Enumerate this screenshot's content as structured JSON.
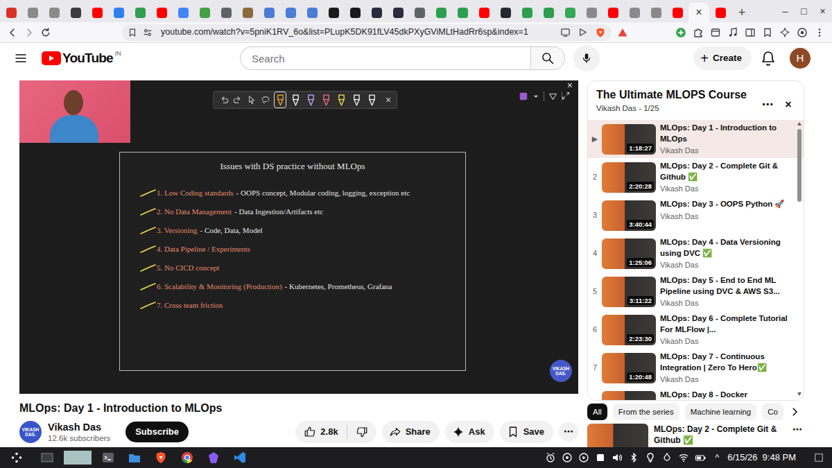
{
  "browser": {
    "tabs": [
      {
        "color": "#d93025",
        "selected": false
      },
      {
        "color": "#8a8a8a",
        "selected": false
      },
      {
        "color": "#8a8a8a",
        "selected": false
      },
      {
        "color": "#3b3b3b",
        "selected": false
      },
      {
        "color": "#ff0000",
        "selected": false
      },
      {
        "color": "#2f80ed",
        "selected": false
      },
      {
        "color": "#2e9e4f",
        "selected": false
      },
      {
        "color": "#ff0000",
        "selected": false
      },
      {
        "color": "#4285f4",
        "selected": false
      },
      {
        "color": "#43a047",
        "selected": false
      },
      {
        "color": "#5f6368",
        "selected": false
      },
      {
        "color": "#8b6b3d",
        "selected": false
      },
      {
        "color": "#4a7dd6",
        "selected": false
      },
      {
        "color": "#4a7dd6",
        "selected": false
      },
      {
        "color": "#4a7dd6",
        "selected": false
      },
      {
        "color": "#1a1a1a",
        "selected": false
      },
      {
        "color": "#1a1a1a",
        "selected": false
      },
      {
        "color": "#2b2b3b",
        "selected": false
      },
      {
        "color": "#2b2b3b",
        "selected": false
      },
      {
        "color": "#5f6368",
        "selected": false
      },
      {
        "color": "#2e9e4f",
        "selected": false
      },
      {
        "color": "#2e9e4f",
        "selected": false
      },
      {
        "color": "#ff0000",
        "selected": false
      },
      {
        "color": "#24292f",
        "selected": false
      },
      {
        "color": "#2e9e4f",
        "selected": false
      },
      {
        "color": "#2e9e4f",
        "selected": false
      },
      {
        "color": "#34a853",
        "selected": false
      },
      {
        "color": "#8a8a8a",
        "selected": false
      },
      {
        "color": "#ff0000",
        "selected": false
      },
      {
        "color": "#8a8a8a",
        "selected": false
      },
      {
        "color": "#8a8a8a",
        "selected": false
      },
      {
        "color": "#ff0000",
        "selected": false
      },
      {
        "selected": true
      },
      {
        "color": "#ff0000",
        "selected": false
      }
    ],
    "tab_close": "×",
    "new_tab": "+",
    "window_controls": [
      "–",
      "□",
      "×"
    ],
    "url": "youtube.com/watch?v=5pniK1RV_6o&list=PLupK5DK91fLV45dkPXyGViMLtHadRr6sp&index=1"
  },
  "header": {
    "logo": "YouTube",
    "region": "IN",
    "search": {
      "placeholder": "Search"
    },
    "create_icon": "+",
    "create": "Create",
    "avatar": "H"
  },
  "video": {
    "close": "×",
    "annotation_pens": [
      {
        "color": "#f5a623",
        "selected": true
      },
      {
        "color": "#ffffff",
        "selected": false
      },
      {
        "color": "#c4b0ff",
        "selected": false
      },
      {
        "color": "#ff6b8a",
        "selected": false
      },
      {
        "color": "#ffe14d",
        "selected": false
      },
      {
        "color": "#ffffff",
        "selected": false
      },
      {
        "color": "#ffffff",
        "selected": false
      }
    ],
    "annotation_close": "×",
    "slide": {
      "title": "Issues with DS practice without MLOps",
      "items": [
        {
          "label": "1. Low Coding standards",
          "detail": "- OOPS concept, Modular coding, logging, exception etc"
        },
        {
          "label": "2. No Data Management",
          "detail": "- Data Ingestion/Artifacts etc"
        },
        {
          "label": "3. Versioning",
          "detail": "- Code, Data, Model"
        },
        {
          "label": "4. Data Pipeline / Experiments"
        },
        {
          "label": "5. No CICD concept"
        },
        {
          "label": "6. Scalability & Monitoring (Production)",
          "detail": "- Kubernetes, Prometheus, Grafana"
        },
        {
          "label": "7. Cross team friction"
        }
      ]
    },
    "watermark": "VIKASH DAS."
  },
  "title": "MLOps: Day 1 - Introduction to MLOps",
  "channel": {
    "avatar": "VIKASH DAS.",
    "name": "Vikash Das",
    "subscribers": "12.6k subscribers",
    "subscribe": "Subscribe"
  },
  "actions": {
    "likes": "2.8k",
    "buttons": [
      "Share",
      "Ask",
      "Save"
    ],
    "more": "⋯"
  },
  "playlist": {
    "title": "The Ultimate MLOPS Course",
    "meta": "Vikash Das - 1/25",
    "more": "⋯",
    "close": "×",
    "items": [
      {
        "index": "▶",
        "title": "MLOps: Day 1 - Introduction to MLOps",
        "duration": "1:18:27",
        "channel": "Vikash Das",
        "selected": true
      },
      {
        "index": "2",
        "title": "MLOps: Day 2 - Complete Git & Github ✅",
        "duration": "2:20:28",
        "channel": "Vikash Das",
        "selected": false
      },
      {
        "index": "3",
        "title": "MLOps: Day 3 - OOPS Python 🚀",
        "duration": "3:40:44",
        "channel": "Vikash Das",
        "selected": false
      },
      {
        "index": "4",
        "title": "MLOps: Day 4 - Data Versioning using DVC ✅",
        "duration": "1:25:06",
        "channel": "Vikash Das",
        "selected": false
      },
      {
        "index": "5",
        "title": "MLOps: Day 5 - End to End ML Pipeline using DVC & AWS S3...",
        "duration": "3:11:22",
        "channel": "Vikash Das",
        "selected": false
      },
      {
        "index": "6",
        "title": "MLOps: Day 6 - Complete Tutorial For MLFlow |...",
        "duration": "2:23:30",
        "channel": "Vikash Das",
        "selected": false
      },
      {
        "index": "7",
        "title": "MLOps: Day 7 - Continuous Integration | Zero To Hero✅",
        "duration": "1:20:48",
        "channel": "Vikash Das",
        "selected": false
      },
      {
        "title": "MLOps: Day 8 - Docker",
        "selected": false
      }
    ]
  },
  "chips": [
    {
      "label": "All",
      "selected": true
    },
    {
      "label": "From the series",
      "selected": false
    },
    {
      "label": "Machine learning",
      "selected": false
    },
    {
      "label": "Co",
      "selected": false
    }
  ],
  "related": {
    "title": "MLOps: Day 2 - Complete Git & Github ✅",
    "more": "⋯"
  },
  "taskbar": {
    "tray_expand": "^",
    "date": "6/15/26",
    "time": "9:48 PM"
  }
}
